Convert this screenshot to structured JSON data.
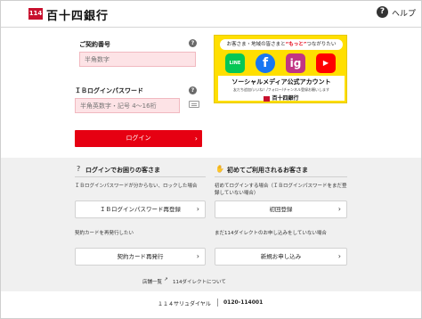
{
  "header": {
    "logo_mark": "114",
    "logo_text": "百十四銀行",
    "help_icon": "question-circle-icon",
    "help_label": "ヘルプ"
  },
  "login_form": {
    "contract_label": "ご契約番号",
    "contract_placeholder": "半角数字",
    "password_label": "ＩＢログインパスワード",
    "password_placeholder": "半角英数字・記号 4～16桁",
    "login_button": "ログイン",
    "accent_color": "#e60012"
  },
  "banner": {
    "top_text_before": "お客さま・地域の皆さまと",
    "top_text_highlight": "“もっと”",
    "top_text_after": "つながりたい",
    "sns": [
      "LINE",
      "f",
      "ig",
      "▶"
    ],
    "title": "ソーシャルメディア公式アカウント",
    "subtitle": "友だち追加/いいね！/フォロー/チャンネル登録お願いします",
    "logo": "百十四銀行"
  },
  "help_section": {
    "left_title": "ログインでお困りの客さま",
    "left_desc_1": "ＩＢログインパスワードが分からない、ロックした場合",
    "left_btn_1": "ＩＢログインパスワード再登録",
    "left_desc_2": "契約カードを再発行したい",
    "left_btn_2": "契約カード再発行",
    "right_title": "初めてご利用されるお客さま",
    "right_desc_1": "初めてログインする場合（ＩＢログインパスワードをまだ登録していない場合）",
    "right_btn_1": "初回登録",
    "right_desc_2": "まだ114ダイレクトのお申し込みをしていない場合",
    "right_btn_2": "新規お申し込み"
  },
  "footer": {
    "store_link": "店舗一覧",
    "about_link": "114ダイレクトについて",
    "dial_label": "１１４サリュダイヤル",
    "phone": "0120-114001"
  }
}
